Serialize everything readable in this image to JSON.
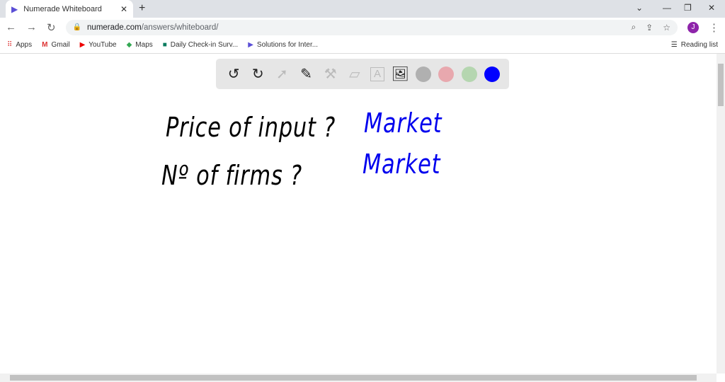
{
  "browser": {
    "tab_title": "Numerade Whiteboard",
    "url_host": "numerade.com",
    "url_path": "/answers/whiteboard/",
    "avatar_letter": "J",
    "reading_list": "Reading list"
  },
  "bookmarks": [
    "Apps",
    "Gmail",
    "YouTube",
    "Maps",
    "Daily Check-in Surv...",
    "Solutions for Inter..."
  ],
  "toolbar": {
    "colors": [
      "#b0b0b0",
      "#e8a8ae",
      "#b5d6b0",
      "#0000ff"
    ]
  },
  "whiteboard": {
    "lines_black": [
      "Price of input ?",
      "Nº of firms ?"
    ],
    "lines_blue": [
      "Market",
      "Market"
    ]
  }
}
